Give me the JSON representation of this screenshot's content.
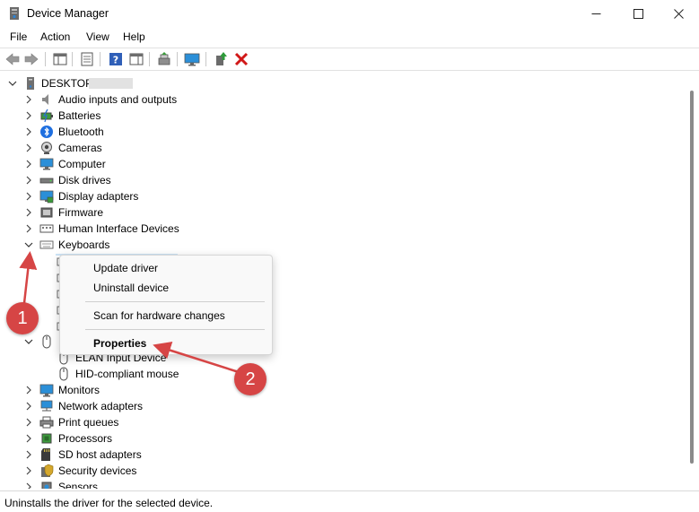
{
  "window": {
    "title": "Device Manager",
    "icon": "device-manager-icon"
  },
  "menu": [
    "File",
    "Action",
    "View",
    "Help"
  ],
  "toolbar": {
    "icons": [
      "back-arrow-icon",
      "forward-arrow-icon",
      "show-hide-tree-icon",
      "properties-sheet-icon",
      "help-icon",
      "action-pane-icon",
      "scan-hardware-icon",
      "monitor-icon",
      "update-driver-icon",
      "uninstall-x-icon"
    ]
  },
  "tree": {
    "computer_name": "DESKTOP-",
    "categories_top": [
      {
        "label": "Audio inputs and outputs",
        "icon": "speaker-icon"
      },
      {
        "label": "Batteries",
        "icon": "battery-icon"
      },
      {
        "label": "Bluetooth",
        "icon": "bluetooth-icon"
      },
      {
        "label": "Cameras",
        "icon": "camera-icon"
      },
      {
        "label": "Computer",
        "icon": "computer-icon"
      },
      {
        "label": "Disk drives",
        "icon": "disk-drive-icon"
      },
      {
        "label": "Display adapters",
        "icon": "display-adapter-icon"
      },
      {
        "label": "Firmware",
        "icon": "firmware-icon"
      },
      {
        "label": "Human Interface Devices",
        "icon": "hid-icon"
      },
      {
        "label": "Keyboards",
        "icon": "keyboard-icon"
      }
    ],
    "mice_children": [
      "ELAN Input Device",
      "HID-compliant mouse"
    ],
    "categories_bottom": [
      {
        "label": "Monitors",
        "icon": "monitor-icon"
      },
      {
        "label": "Network adapters",
        "icon": "network-icon"
      },
      {
        "label": "Print queues",
        "icon": "printer-icon"
      },
      {
        "label": "Processors",
        "icon": "processor-icon"
      },
      {
        "label": "SD host adapters",
        "icon": "sd-card-icon"
      },
      {
        "label": "Security devices",
        "icon": "security-icon"
      },
      {
        "label": "Sensors",
        "icon": "sensor-icon"
      }
    ]
  },
  "context_menu": {
    "update_driver": "Update driver",
    "uninstall_device": "Uninstall device",
    "scan": "Scan for hardware changes",
    "properties": "Properties"
  },
  "annotations": {
    "badge1": "1",
    "badge2": "2",
    "color": "#d64545"
  },
  "status": "Uninstalls the driver for the selected device."
}
